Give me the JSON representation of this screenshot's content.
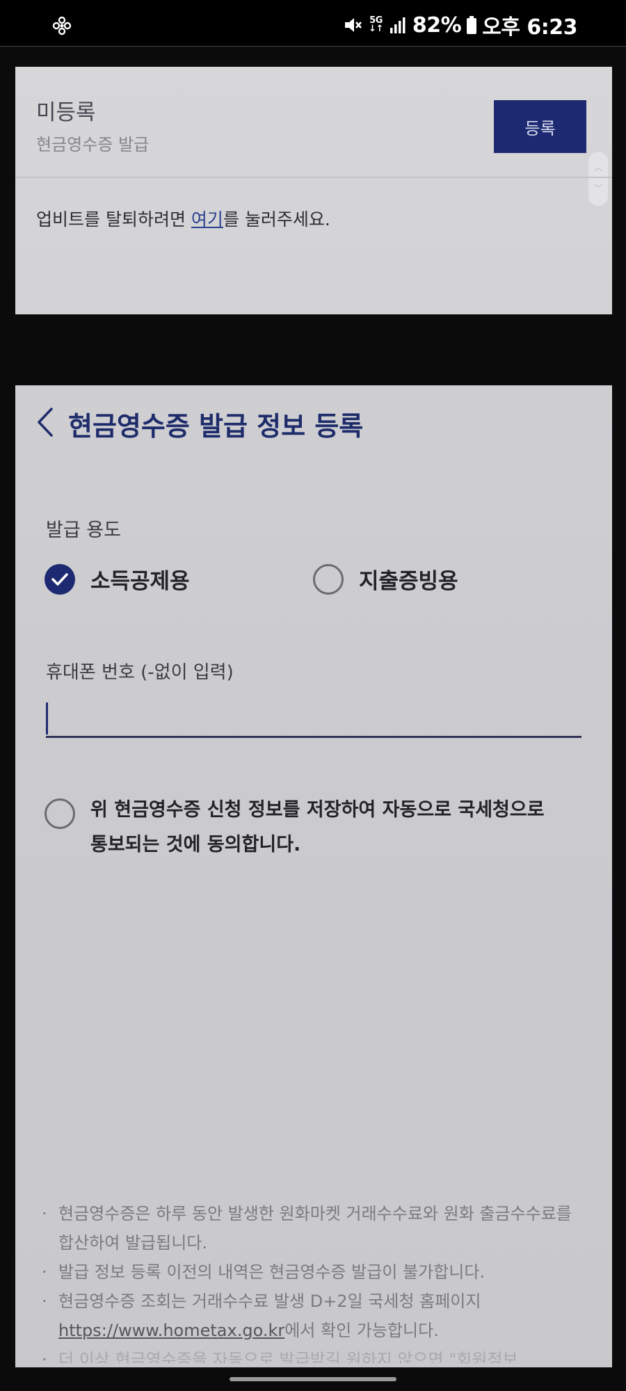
{
  "status_bar": {
    "battery": "82%",
    "time": "오후 6:23",
    "network": "5G"
  },
  "registration_card": {
    "status": "미등록",
    "subtitle": "현금영수증 발급",
    "register_button": "등록",
    "withdraw_text_before": "업비트를 탈퇴하려면 ",
    "withdraw_link": "여기",
    "withdraw_text_after": "를 눌러주세요."
  },
  "form": {
    "title": "현금영수증 발급 정보 등록",
    "purpose_label": "발급 용도",
    "purpose_options": [
      {
        "label": "소득공제용",
        "selected": true
      },
      {
        "label": "지출증빙용",
        "selected": false
      }
    ],
    "phone_label": "휴대폰 번호 (-없이 입력)",
    "phone_value": "",
    "consent_text": "위 현금영수증 신청 정보를 저장하여 자동으로 국세청으로 통보되는 것에 동의합니다.",
    "consent_checked": false
  },
  "notes": {
    "n1": "현금영수증은 하루 동안 발생한 원화마켓 거래수수료와 원화 출금수수료를 합산하여 발급됩니다.",
    "n2": "발급 정보 등록 이전의 내역은 현금영수증 발급이 불가합니다.",
    "n3_before": "현금영수증 조회는 거래수수료 발생 D+2일 국세청 홈페이지 ",
    "n3_url": "https://www.hometax.go.kr",
    "n3_after": "에서 확인 가능합니다.",
    "n4": "더 이상 현금영수증을 자동으로 발급받길 원하지 않으면 \"회원정보"
  },
  "colors": {
    "accent": "#1d2a72",
    "title": "#1f2c6b",
    "link": "#2b3f8f"
  },
  "icons": {
    "back": "chevron-left-icon",
    "check": "check-icon",
    "mute": "mute-icon",
    "signal": "signal-icon",
    "battery": "battery-icon",
    "app": "flower-icon"
  }
}
